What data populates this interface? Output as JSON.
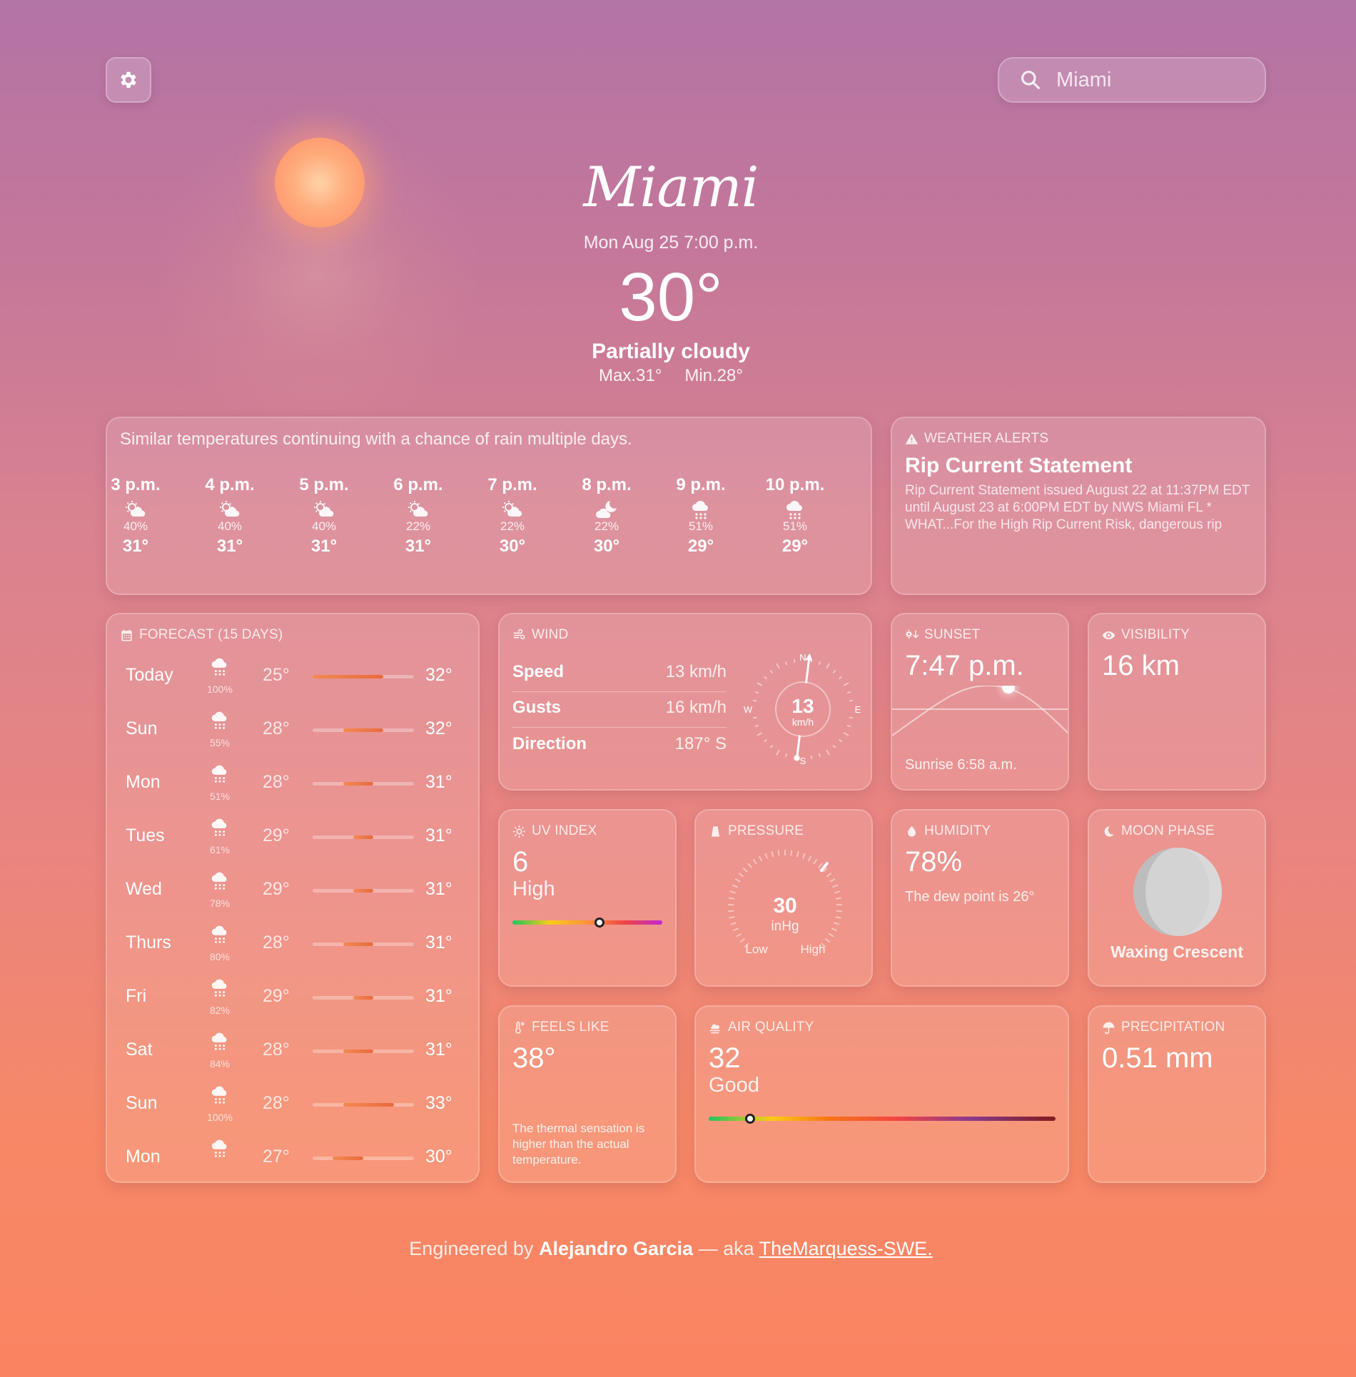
{
  "search": {
    "placeholder": "Miami",
    "value": ""
  },
  "hero": {
    "city": "Miami",
    "datetime": "Mon Aug 25 7:00 p.m.",
    "temperature": "30°",
    "condition": "Partially cloudy",
    "max": "Max.31°",
    "min": "Min.28°"
  },
  "hourly": {
    "summary": "Similar temperatures continuing with a chance of rain multiple days.",
    "hours": [
      {
        "time": "3 p.m.",
        "icon": "partly-cloudy-day-icon",
        "precip": "40%",
        "temp": "31°"
      },
      {
        "time": "4 p.m.",
        "icon": "partly-cloudy-day-icon",
        "precip": "40%",
        "temp": "31°"
      },
      {
        "time": "5 p.m.",
        "icon": "partly-cloudy-day-icon",
        "precip": "40%",
        "temp": "31°"
      },
      {
        "time": "6 p.m.",
        "icon": "partly-cloudy-day-icon",
        "precip": "22%",
        "temp": "31°"
      },
      {
        "time": "7 p.m.",
        "icon": "partly-cloudy-day-icon",
        "precip": "22%",
        "temp": "30°"
      },
      {
        "time": "8 p.m.",
        "icon": "partly-cloudy-night-icon",
        "precip": "22%",
        "temp": "30°"
      },
      {
        "time": "9 p.m.",
        "icon": "rain-cloud-icon",
        "precip": "51%",
        "temp": "29°"
      },
      {
        "time": "10 p.m.",
        "icon": "rain-cloud-icon",
        "precip": "51%",
        "temp": "29°"
      }
    ]
  },
  "alerts": {
    "label": "WEATHER ALERTS",
    "title": "Rip Current Statement",
    "text": "Rip Current Statement issued August 22 at 11:37PM EDT until August 23 at 6:00PM EDT by NWS Miami FL * WHAT...For the High Rip Current Risk, dangerous rip currents. * WHERE...Coastal Broward County, Coastal Miami Dade County. * WHEN...Through Saturday"
  },
  "forecast": {
    "label": "FORECAST (15 DAYS)",
    "days": [
      {
        "day": "Today",
        "precip": "100%",
        "lo": "25°",
        "hi": "32°",
        "bar_start": 0.0,
        "bar_end": 0.7
      },
      {
        "day": "Sun",
        "precip": "55%",
        "lo": "28°",
        "hi": "32°",
        "bar_start": 0.3,
        "bar_end": 0.7
      },
      {
        "day": "Mon",
        "precip": "51%",
        "lo": "28°",
        "hi": "31°",
        "bar_start": 0.3,
        "bar_end": 0.6
      },
      {
        "day": "Tues",
        "precip": "61%",
        "lo": "29°",
        "hi": "31°",
        "bar_start": 0.4,
        "bar_end": 0.6
      },
      {
        "day": "Wed",
        "precip": "78%",
        "lo": "29°",
        "hi": "31°",
        "bar_start": 0.4,
        "bar_end": 0.6
      },
      {
        "day": "Thurs",
        "precip": "80%",
        "lo": "28°",
        "hi": "31°",
        "bar_start": 0.3,
        "bar_end": 0.6
      },
      {
        "day": "Fri",
        "precip": "82%",
        "lo": "29°",
        "hi": "31°",
        "bar_start": 0.4,
        "bar_end": 0.6
      },
      {
        "day": "Sat",
        "precip": "84%",
        "lo": "28°",
        "hi": "31°",
        "bar_start": 0.3,
        "bar_end": 0.6
      },
      {
        "day": "Sun",
        "precip": "100%",
        "lo": "28°",
        "hi": "33°",
        "bar_start": 0.3,
        "bar_end": 0.8
      },
      {
        "day": "Mon",
        "precip": "",
        "lo": "27°",
        "hi": "30°",
        "bar_start": 0.2,
        "bar_end": 0.5
      }
    ]
  },
  "wind": {
    "label": "WIND",
    "speed_label": "Speed",
    "speed": "13 km/h",
    "gusts_label": "Gusts",
    "gusts": "16 km/h",
    "direction_label": "Direction",
    "direction": "187° S",
    "compass_value": "13",
    "compass_unit": "km/h",
    "n": "N",
    "s": "S",
    "e": "E",
    "w": "W",
    "direction_deg": 187
  },
  "sunset": {
    "label": "SUNSET",
    "time": "7:47 p.m.",
    "sunrise": "Sunrise 6:58 a.m."
  },
  "visibility": {
    "label": "VISIBILITY",
    "value": "16 km"
  },
  "uv": {
    "label": "UV INDEX",
    "value": "6",
    "level": "High",
    "position": 0.58
  },
  "pressure": {
    "label": "PRESSURE",
    "value": "30",
    "unit": "inHg",
    "low": "Low",
    "high": "High"
  },
  "humidity": {
    "label": "HUMIDITY",
    "value": "78%",
    "dew": "The dew point is 26°"
  },
  "moon": {
    "label": "MOON PHASE",
    "phase": "Waxing Crescent"
  },
  "feels": {
    "label": "FEELS LIKE",
    "value": "38°",
    "text": "The thermal sensation is higher than the actual temperature."
  },
  "air": {
    "label": "AIR QUALITY",
    "value": "32",
    "level": "Good",
    "position": 0.12
  },
  "precip": {
    "label": "PRECIPITATION",
    "value": "0.51 mm"
  },
  "footer": {
    "prefix": "Engineered by",
    "author": "Alejandro Garcia",
    "aka": "— aka",
    "handle": "TheMarquess-SWE."
  },
  "colors": {
    "uv_bar": [
      "#22c55e",
      "#facc15",
      "#fb923c",
      "#ef4444",
      "#c026d3"
    ],
    "aq_bar": [
      "#22c55e",
      "#facc15",
      "#f97316",
      "#ef4444",
      "#8b3a8f",
      "#7f1d1d"
    ]
  }
}
